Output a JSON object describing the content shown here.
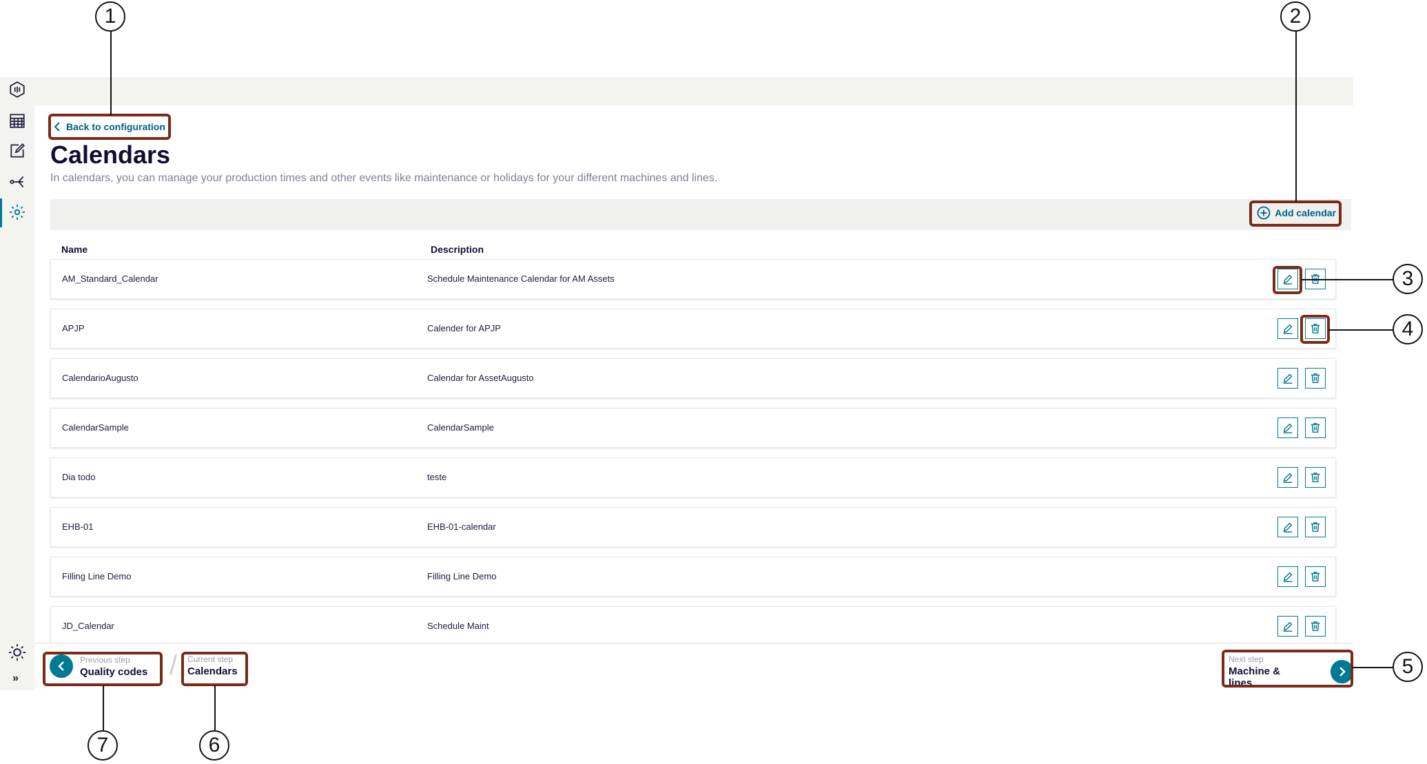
{
  "nav": {
    "items": [
      {
        "icon": "dashboard-icon"
      },
      {
        "icon": "calendar-icon"
      },
      {
        "icon": "edit-note-icon"
      },
      {
        "icon": "flow-icon"
      },
      {
        "icon": "settings-gear-icon",
        "active": true
      }
    ],
    "theme_icon": "sun-theme-icon",
    "expand_label": "»"
  },
  "header": {
    "back_link": "Back to configuration",
    "title": "Calendars",
    "subtitle": "In calendars, you can manage your production times and other events like maintenance or holidays for your different machines and lines."
  },
  "toolbar": {
    "add_label": "Add calendar"
  },
  "table": {
    "columns": [
      "Name",
      "Description"
    ],
    "rows": [
      {
        "name": "AM_Standard_Calendar",
        "description": "Schedule Maintenance Calendar for AM Assets"
      },
      {
        "name": "APJP",
        "description": "Calender for APJP"
      },
      {
        "name": "CalendarioAugusto",
        "description": "Calendar for AssetAugusto"
      },
      {
        "name": "CalendarSample",
        "description": "CalendarSample"
      },
      {
        "name": "Dia todo",
        "description": "teste"
      },
      {
        "name": "EHB-01",
        "description": "EHB-01-calendar"
      },
      {
        "name": "Filling Line Demo",
        "description": "Filling Line Demo"
      },
      {
        "name": "JD_Calendar",
        "description": "Schedule Maint"
      }
    ]
  },
  "stepper": {
    "previous": {
      "caption": "Previous step",
      "label": "Quality codes"
    },
    "current": {
      "caption": "Current step",
      "label": "Calendars"
    },
    "next": {
      "caption": "Next step",
      "label": "Machine & lines"
    }
  },
  "callouts": [
    "1",
    "2",
    "3",
    "4",
    "5",
    "6",
    "7"
  ],
  "colors": {
    "accent": "#007993",
    "highlight": "#7a2a16",
    "title": "#0f0f32"
  }
}
